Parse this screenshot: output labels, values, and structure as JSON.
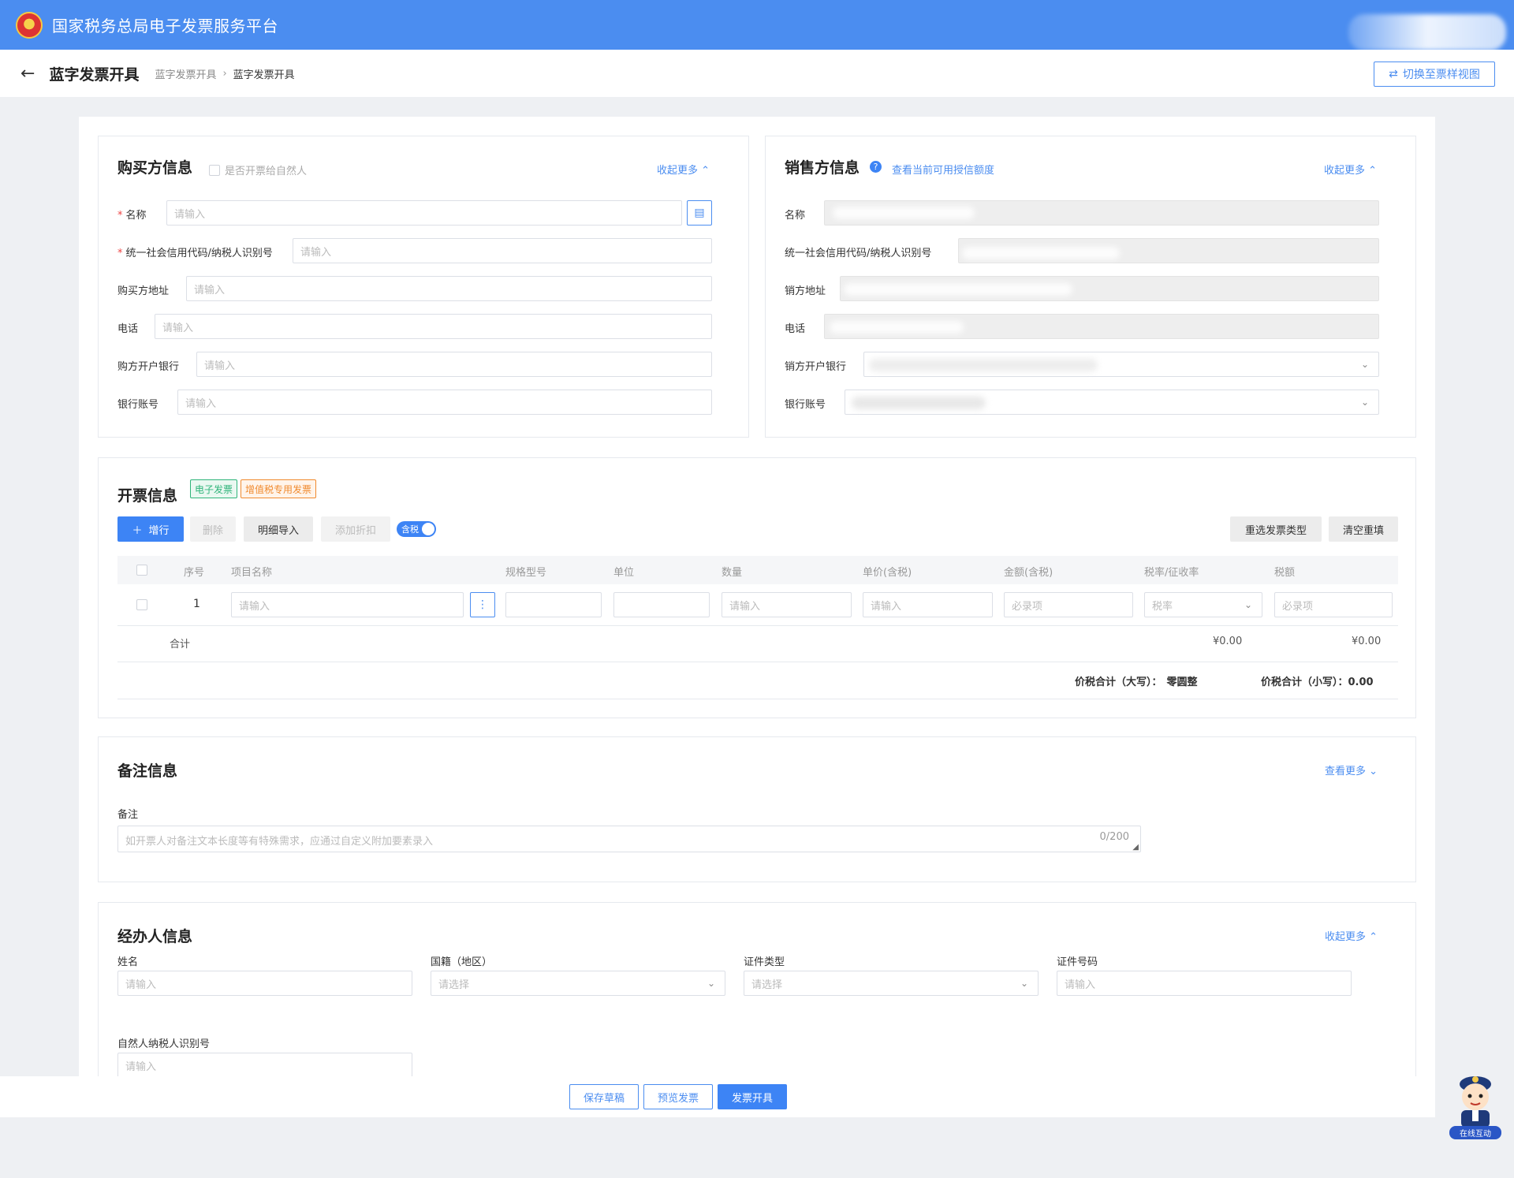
{
  "header": {
    "title": "国家税务总局电子发票服务平台"
  },
  "subheader": {
    "page_title": "蓝字发票开具",
    "breadcrumb": [
      "蓝字发票开具",
      "蓝字发票开具"
    ],
    "switch_label": "切换至票样视图"
  },
  "buyer": {
    "title": "购买方信息",
    "natural_person_label": "是否开票给自然人",
    "collapse_label": "收起更多",
    "fields": [
      {
        "label": "名称",
        "required": true,
        "placeholder": "请输入"
      },
      {
        "label": "统一社会信用代码/纳税人识别号",
        "required": true,
        "placeholder": "请输入"
      },
      {
        "label": "购买方地址",
        "required": false,
        "placeholder": "请输入"
      },
      {
        "label": "电话",
        "required": false,
        "placeholder": "请输入"
      },
      {
        "label": "购方开户银行",
        "required": false,
        "placeholder": "请输入"
      },
      {
        "label": "银行账号",
        "required": false,
        "placeholder": "请输入"
      }
    ]
  },
  "seller": {
    "title": "销售方信息",
    "credit_link": "查看当前可用授信额度",
    "collapse_label": "收起更多",
    "fields": [
      {
        "label": "名称"
      },
      {
        "label": "统一社会信用代码/纳税人识别号"
      },
      {
        "label": "销方地址"
      },
      {
        "label": "电话"
      },
      {
        "label": "销方开户银行"
      },
      {
        "label": "银行账号"
      }
    ]
  },
  "invoice": {
    "title": "开票信息",
    "tags": [
      "电子发票",
      "增值税专用发票"
    ],
    "buttons": {
      "add_row": "增行",
      "delete": "删除",
      "import": "明细导入",
      "add_discount": "添加折扣",
      "tax_toggle": "含税",
      "reselect": "重选发票类型",
      "clear": "清空重填"
    },
    "columns": [
      "序号",
      "项目名称",
      "规格型号",
      "单位",
      "数量",
      "单价(含税)",
      "金额(含税)",
      "税率/征收率",
      "税额"
    ],
    "rows": [
      {
        "index": "1",
        "name_placeholder": "请输入",
        "qty_placeholder": "请输入",
        "price_placeholder": "请输入",
        "amount_placeholder": "必录项",
        "rate_placeholder": "税率",
        "tax_placeholder": "必录项"
      }
    ],
    "total_label": "合计",
    "total_amount": "¥0.00",
    "total_tax": "¥0.00",
    "sum_upper_label": "价税合计（大写）：",
    "sum_upper_value": "零圆整",
    "sum_lower_label": "价税合计（小写）：",
    "sum_lower_value": "0.00"
  },
  "remarks": {
    "title": "备注信息",
    "more_label": "查看更多",
    "field_label": "备注",
    "placeholder": "如开票人对备注文本长度等有特殊需求，应通过自定义附加要素录入",
    "counter": "0/200"
  },
  "handler": {
    "title": "经办人信息",
    "collapse_label": "收起更多",
    "fields": [
      {
        "label": "姓名",
        "placeholder": "请输入"
      },
      {
        "label": "国籍（地区）",
        "placeholder": "请选择"
      },
      {
        "label": "证件类型",
        "placeholder": "请选择"
      },
      {
        "label": "证件号码",
        "placeholder": "请输入"
      },
      {
        "label": "自然人纳税人识别号",
        "placeholder": "请输入"
      }
    ]
  },
  "footer": {
    "save_draft": "保存草稿",
    "preview": "预览发票",
    "issue": "发票开具"
  },
  "help": {
    "label": "在线互动"
  },
  "colors": {
    "primary": "#3d84f5",
    "header": "#4b8df0",
    "tag_green": "#2fb47a",
    "tag_orange": "#f08a2e"
  }
}
